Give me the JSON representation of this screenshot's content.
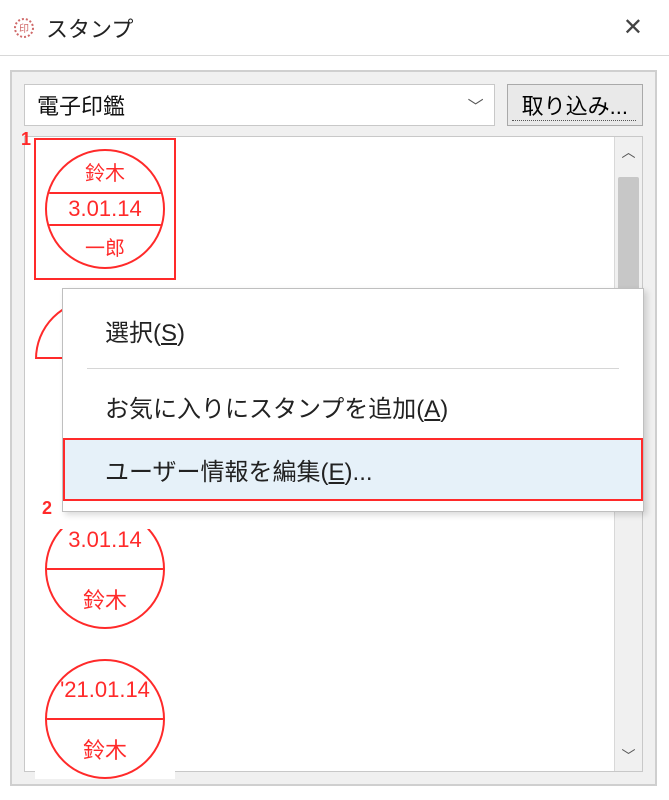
{
  "window": {
    "title": "スタンプ"
  },
  "toolbar": {
    "dropdown_value": "電子印鑑",
    "import_label": "取り込み..."
  },
  "stamps": [
    {
      "top": "鈴木",
      "mid": "3.01.14",
      "bot": "一郎",
      "layout": "three",
      "selected": true
    },
    {
      "top": "",
      "mid": "",
      "bot": "",
      "layout": "hidden"
    },
    {
      "top": "3.01.14",
      "mid": "",
      "bot": "鈴木",
      "layout": "two"
    },
    {
      "top": "'21.01.14",
      "mid": "",
      "bot": "鈴木",
      "layout": "two"
    }
  ],
  "markers": {
    "one": "1",
    "two": "2"
  },
  "context_menu": {
    "items": [
      {
        "label_pre": "選択(",
        "mnemonic": "S",
        "label_post": ")"
      },
      {
        "label_pre": "お気に入りにスタンプを追加(",
        "mnemonic": "A",
        "label_post": ")"
      },
      {
        "label_pre": "ユーザー情報を編集(",
        "mnemonic": "E",
        "label_post": ")...",
        "hover": true
      }
    ]
  }
}
